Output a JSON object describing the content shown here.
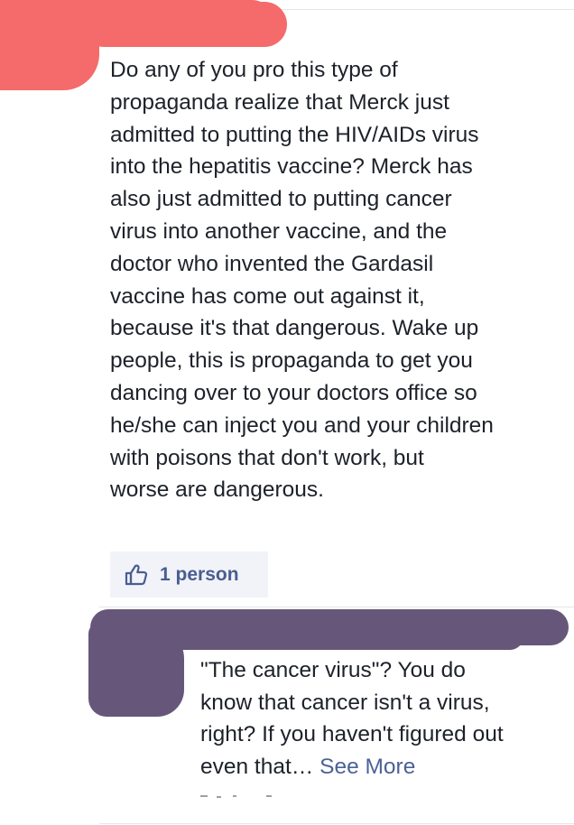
{
  "post": {
    "lines": [
      "Do any of you pro this type of",
      "propaganda realize that Merck just",
      "admitted to putting the HIV/AIDs virus",
      "into the hepatitis vaccine? Merck has",
      "also just admitted to putting cancer",
      "virus into another vaccine, and the",
      "doctor who invented the Gardasil",
      "vaccine has come out against it,",
      "because it's that dangerous. Wake up",
      "people, this is propaganda to get you",
      "dancing over to your doctors office so",
      "he/she can inject you and your children",
      "with poisons that don't work, but",
      "worse are dangerous."
    ],
    "likes_label": "1 person"
  },
  "reply": {
    "lines": [
      "\"The cancer virus\"? You do",
      "know that cancer isn't a virus,",
      "right? If you haven't figured out"
    ],
    "last_line": "even that… ",
    "see_more": "See More"
  },
  "icons": {
    "like": "thumbs-up-icon"
  },
  "colors": {
    "redaction_top": "#f56a6a",
    "redaction_reply": "#66577a",
    "link": "#4c6296",
    "like_box": "#f1f3f8"
  }
}
